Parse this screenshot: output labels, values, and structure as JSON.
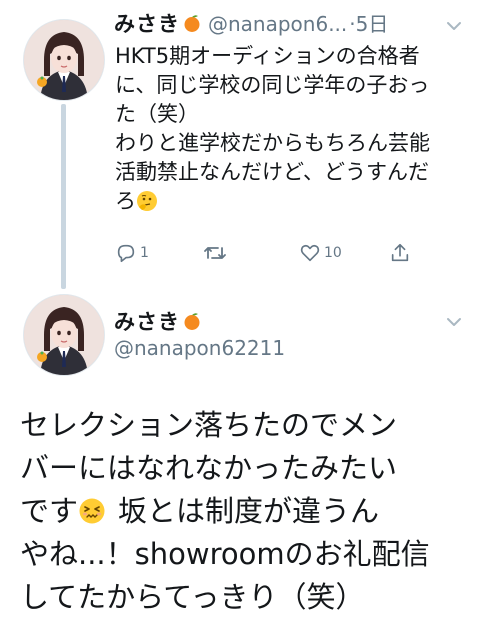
{
  "colors": {
    "text": "#14171a",
    "secondary": "#657786",
    "thread_line": "#c9d6e0",
    "background": "#ffffff"
  },
  "reply_tweet": {
    "display_name": "みさき",
    "name_emoji": "tangerine",
    "handle_truncated": "@nanapon6...",
    "separator": "·",
    "timestamp": "5日",
    "text_lines": [
      "HKT5期オーディションの合格者",
      "に、同じ学校の同じ学年の子おっ",
      "た（笑）",
      "わりと進学校だからもちろん芸能",
      "活動禁止なんだけど、どうすんだ",
      "ろ"
    ],
    "trailing_emoji": "thinking-face",
    "actions": {
      "reply_count": "1",
      "retweet_count": "",
      "like_count": "10"
    }
  },
  "main_tweet": {
    "display_name": "みさき",
    "name_emoji": "tangerine",
    "handle": "@nanapon62211",
    "text_lines": [
      "セレクション落ちたのでメン",
      "バーにはなれなかったみたい",
      "です",
      "坂とは制度が違うん",
      "やね...！showroomのお礼配信",
      "してたからてっきり（笑）"
    ],
    "inline_emoji": "persevering-face"
  }
}
